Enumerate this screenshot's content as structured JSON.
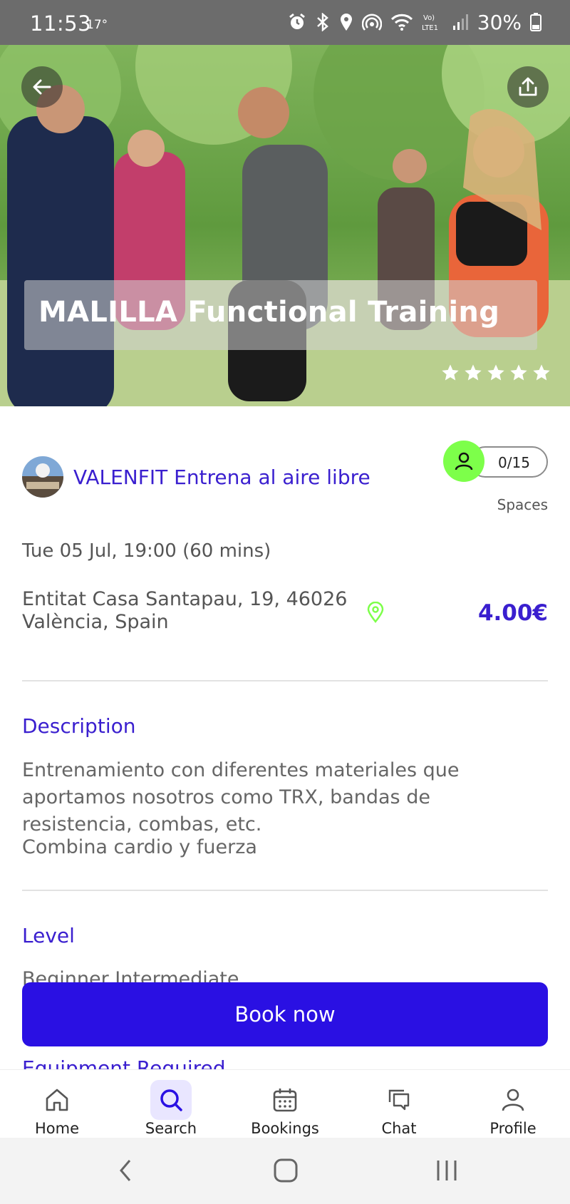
{
  "status_bar": {
    "time": "11:53",
    "temperature": "17°",
    "battery": "30%",
    "icons": [
      "alarm-icon",
      "bluetooth-icon",
      "location-icon",
      "hotspot-icon",
      "wifi-icon",
      "volte-icon",
      "signal-icon",
      "battery-icon"
    ]
  },
  "hero": {
    "title": "MALILLA Functional Training",
    "rating": 5
  },
  "organizer": {
    "name": "VALENFIT Entrena al aire libre"
  },
  "spaces": {
    "count": "0/15",
    "label": "Spaces"
  },
  "event": {
    "datetime": "Tue 05 Jul, 19:00 (60 mins)",
    "address_line1": "Entitat Casa Santapau, 19, 46026",
    "address_line2": "València, Spain",
    "price": "4.00€"
  },
  "description": {
    "title": "Description",
    "line1": "Entrenamiento con diferentes materiales que",
    "line2": "aportamos nosotros como TRX, bandas de",
    "line3": "resistencia, combas, etc.",
    "line4": "Combina cardio y fuerza"
  },
  "level": {
    "title": "Level",
    "value": "Beginner Intermediate"
  },
  "equipment": {
    "title": "Equipment Required"
  },
  "book_button": "Book now",
  "nav": {
    "items": [
      {
        "label": "Home"
      },
      {
        "label": "Search"
      },
      {
        "label": "Bookings"
      },
      {
        "label": "Chat"
      },
      {
        "label": "Profile"
      }
    ]
  },
  "colors": {
    "accent": "#3a1fcf",
    "button": "#2a10e3",
    "green": "#7dff4a"
  }
}
